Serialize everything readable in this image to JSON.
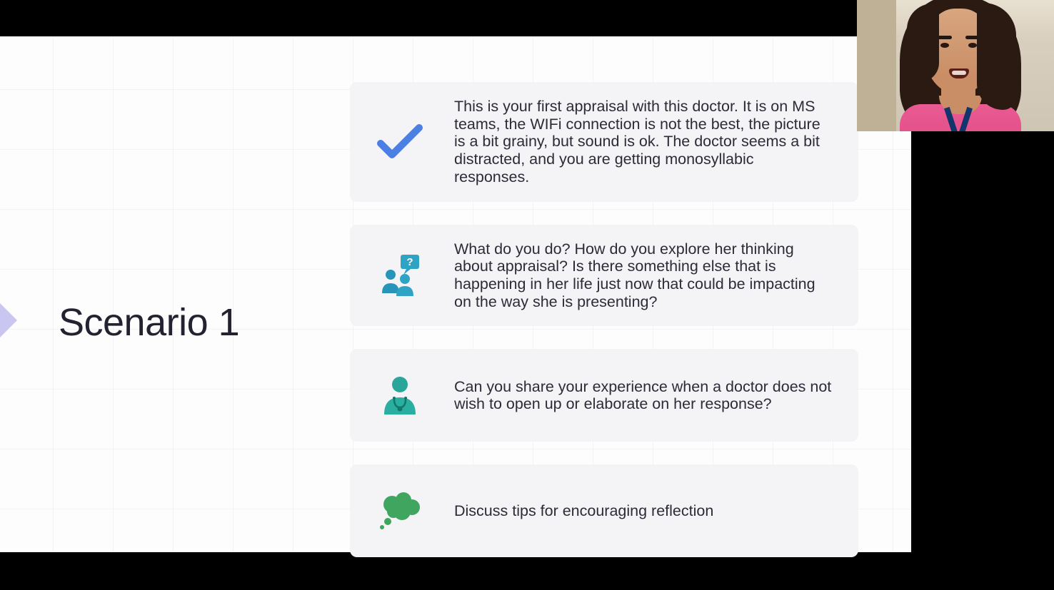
{
  "slide": {
    "title": "Scenario 1",
    "cards": [
      {
        "icon": "check-icon",
        "text": "This is your first appraisal with this doctor. It is on MS teams, the  WIFi connection is not  the best, the picture is a bit grainy, but sound is ok. The doctor seems a bit distracted, and you are getting monosyllabic responses."
      },
      {
        "icon": "question-people-icon",
        "text": "What do you do? How do you explore her thinking about appraisal? Is there something else that is happening in her life just now that could be impacting on the way she is presenting?"
      },
      {
        "icon": "doctor-icon",
        "text": "Can you share your experience when a doctor does not wish to open up or elaborate on her response?"
      },
      {
        "icon": "thought-cloud-icon",
        "text": "Discuss tips for encouraging reflection"
      }
    ]
  },
  "webcam": {
    "label": "presenter video feed"
  }
}
